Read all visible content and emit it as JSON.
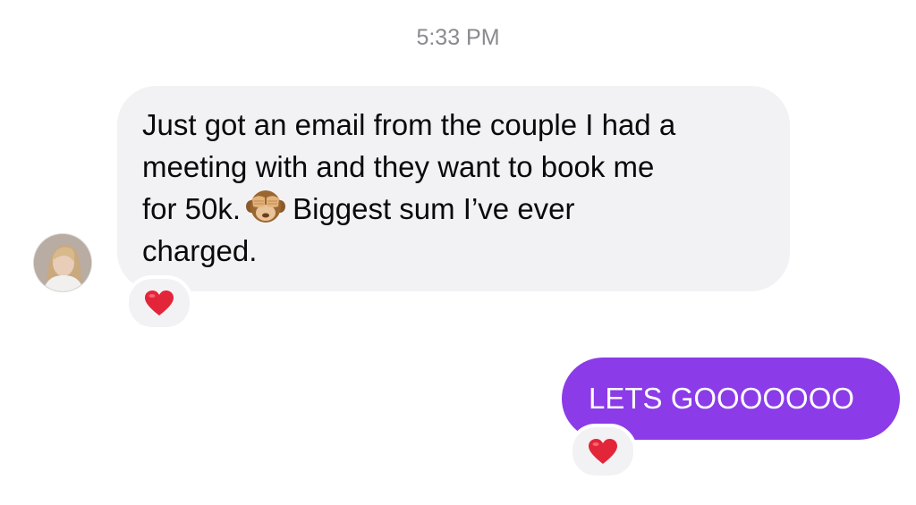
{
  "conversation": {
    "timestamp": "5:33 PM",
    "incoming": {
      "lines": [
        "Just got an email from the couple I had a",
        "meeting with and they want to book me",
        "for 50k.",
        "Biggest sum I’ve ever",
        "charged."
      ],
      "emoji": "see-no-evil-monkey",
      "reaction": "red-heart",
      "bubble_color": "#f2f2f5",
      "sender_avatar": "avatar-photo"
    },
    "outgoing": {
      "text": "LETS GOOOOOOO",
      "reaction": "red-heart",
      "bubble_color": "#8b3be8"
    }
  }
}
